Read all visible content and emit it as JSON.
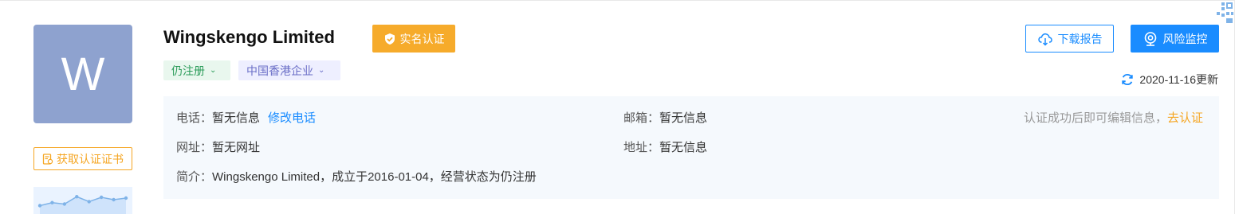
{
  "company": {
    "avatar_letter": "W",
    "name": "Wingskengo Limited",
    "verified_badge": "实名认证",
    "tags": [
      {
        "label": "仍注册",
        "color": "#2d9d5b"
      },
      {
        "label": "中国香港企业",
        "color": "#6b6fc7"
      }
    ]
  },
  "sidebar": {
    "cert_button": "获取认证证书",
    "sparkline": [
      0.3,
      0.45,
      0.38,
      0.75,
      0.5,
      0.72,
      0.6,
      0.68
    ]
  },
  "actions": {
    "download_label": "下载报告",
    "monitor_label": "风险监控"
  },
  "updated": {
    "text": "2020-11-16更新"
  },
  "info": {
    "phone_label": "电话：",
    "phone_value": "暂无信息",
    "phone_edit": "修改电话",
    "email_label": "邮箱：",
    "email_value": "暂无信息",
    "website_label": "网址：",
    "website_value": "暂无网址",
    "address_label": "地址：",
    "address_value": "暂无信息",
    "intro_label": "简介：",
    "intro_value": "Wingskengo Limited，成立于2016-01-04，经营状态为仍注册",
    "note_text": "认证成功后即可编辑信息，",
    "note_link": "去认证"
  },
  "colors": {
    "accent_blue": "#1a8cff",
    "accent_orange": "#f6ab2b",
    "avatar_bg": "#8ea2cf",
    "info_bg": "#f5f9fd"
  }
}
